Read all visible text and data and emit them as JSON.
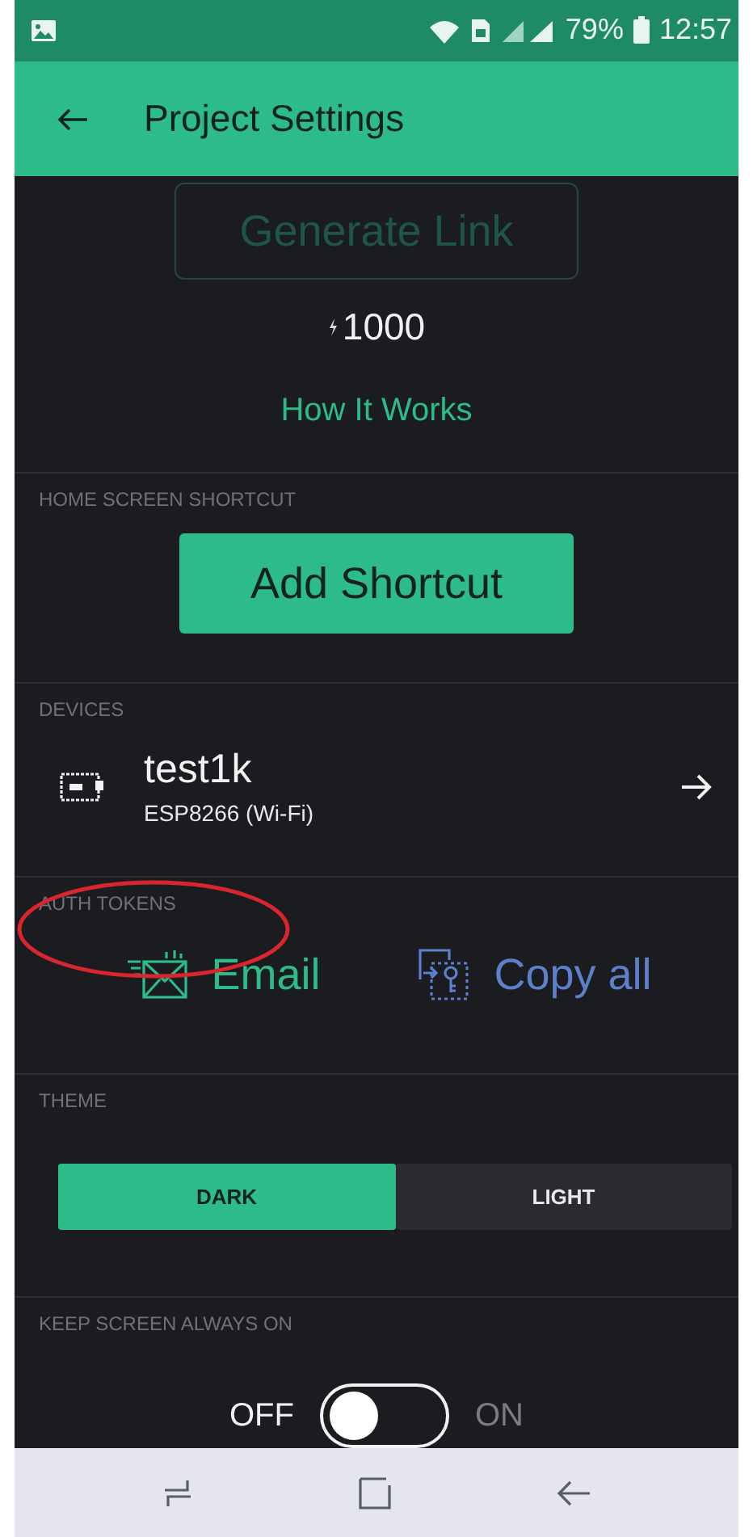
{
  "status_bar": {
    "battery": "79%",
    "time": "12:57"
  },
  "app_bar": {
    "title": "Project Settings"
  },
  "share": {
    "generate_button": {
      "label": "Generate Link",
      "disabled": true
    },
    "energy": "1000",
    "link": "How It Works"
  },
  "home_shortcut": {
    "label": "HOME SCREEN SHORTCUT",
    "button": "Add Shortcut"
  },
  "devices": {
    "label": "DEVICES",
    "items": [
      {
        "name": "test1k",
        "model": "ESP8266 (Wi-Fi)"
      }
    ]
  },
  "auth_tokens": {
    "label": "AUTH TOKENS",
    "actions": [
      {
        "kind": "email",
        "label": "Email"
      },
      {
        "kind": "copy",
        "label": "Copy all"
      }
    ]
  },
  "theme": {
    "label": "THEME",
    "options": [
      {
        "label": "DARK",
        "selected": true
      },
      {
        "label": "LIGHT",
        "selected": false
      }
    ]
  },
  "keep_screen_on": {
    "label": "KEEP SCREEN ALWAYS ON",
    "off_label": "OFF",
    "on_label": "ON",
    "on": false
  },
  "annotations": [
    {
      "kind": "ellipse"
    }
  ]
}
